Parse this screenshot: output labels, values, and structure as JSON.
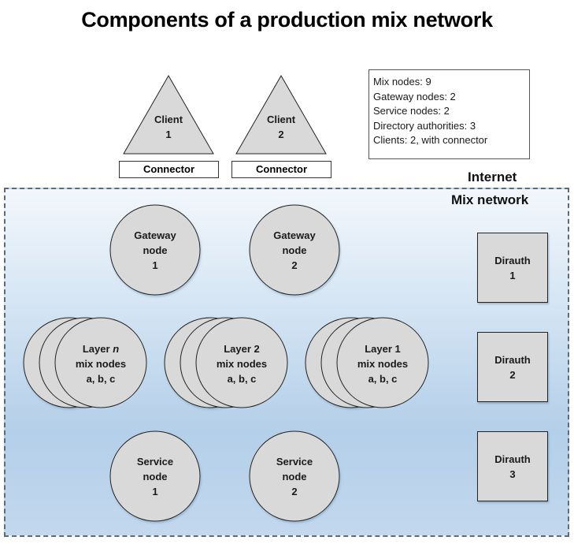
{
  "title": "Components of a production mix network",
  "legend": {
    "lines": [
      "Mix nodes: 9",
      "Gateway nodes: 2",
      "Service nodes: 2",
      "Directory authorities: 3",
      "Clients: 2, with connector"
    ]
  },
  "clients": [
    {
      "line1": "Client",
      "line2": "1",
      "connector": "Connector"
    },
    {
      "line1": "Client",
      "line2": "2",
      "connector": "Connector"
    }
  ],
  "regions": {
    "internet": "Internet",
    "mix_network": "Mix network"
  },
  "gateways": [
    {
      "line1": "Gateway",
      "line2": "node",
      "line3": "1"
    },
    {
      "line1": "Gateway",
      "line2": "node",
      "line3": "2"
    }
  ],
  "mix_layers": [
    {
      "prefix": "Layer",
      "layer": "n",
      "line2": "mix nodes",
      "line3": "a, b, c"
    },
    {
      "prefix": "Layer",
      "layer": "2",
      "line2": "mix nodes",
      "line3": "a, b, c"
    },
    {
      "prefix": "Layer",
      "layer": "1",
      "line2": "mix nodes",
      "line3": "a, b, c"
    }
  ],
  "services": [
    {
      "line1": "Service",
      "line2": "node",
      "line3": "1"
    },
    {
      "line1": "Service",
      "line2": "node",
      "line3": "2"
    }
  ],
  "dirauths": [
    {
      "line1": "Dirauth",
      "line2": "1"
    },
    {
      "line1": "Dirauth",
      "line2": "2"
    },
    {
      "line1": "Dirauth",
      "line2": "3"
    }
  ],
  "colors": {
    "node_fill": "#d9d9d9",
    "node_stroke": "#222222",
    "region_top": "#f3f7fc",
    "region_bottom": "#b4cfe9",
    "region_border": "#5f6a73"
  }
}
